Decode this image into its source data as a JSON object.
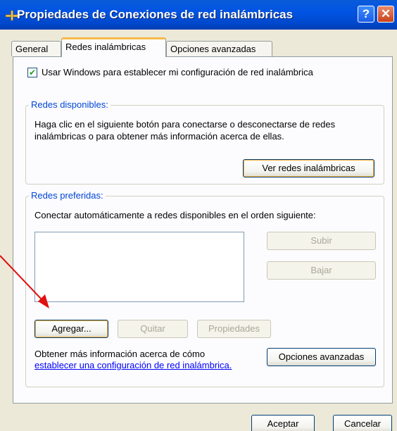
{
  "window": {
    "title": "Propiedades de Conexiones de red inalámbricas",
    "help_glyph": "?",
    "close_glyph": "✕"
  },
  "tabs": [
    {
      "label": "General",
      "selected": false
    },
    {
      "label": "Redes inalámbricas",
      "selected": true
    },
    {
      "label": "Opciones avanzadas",
      "selected": false
    }
  ],
  "use_windows_checkbox": {
    "label": "Usar Windows para establecer mi configuración de red inalámbrica",
    "checked": true,
    "glyph": "✔"
  },
  "available_networks": {
    "legend": "Redes disponibles:",
    "text": "Haga clic en el siguiente botón para conectarse o desconectarse de redes inalámbricas o para obtener más información acerca de ellas.",
    "view_button": "Ver redes inalámbricas"
  },
  "preferred_networks": {
    "legend": "Redes preferidas:",
    "text": "Conectar automáticamente a redes disponibles en el orden siguiente:",
    "items": [],
    "up_button": "Subir",
    "down_button": "Bajar",
    "add_button": "Agregar...",
    "remove_button": "Quitar",
    "properties_button": "Propiedades",
    "info_text": "Obtener más información acerca de cómo",
    "info_link": "establecer una configuración de red inalámbrica.",
    "advanced_button": "Opciones avanzadas"
  },
  "footer": {
    "ok_button": "Aceptar",
    "cancel_button": "Cancelar"
  },
  "colors": {
    "title_bar": "#0054e3",
    "selected_tab_highlight": "#f7b94a",
    "group_legend": "#0046d5",
    "annotation_arrow": "#e01010"
  }
}
